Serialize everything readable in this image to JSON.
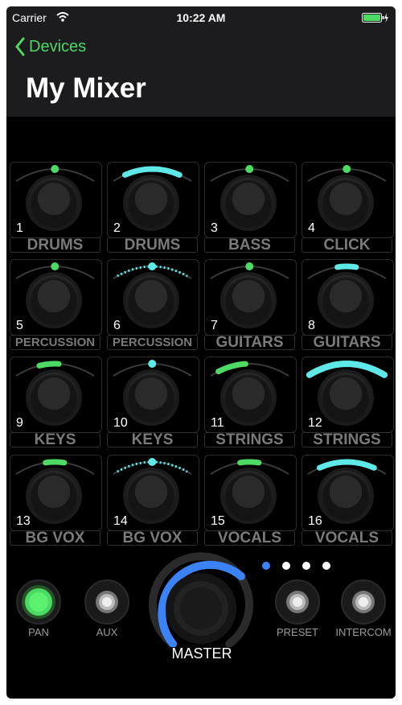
{
  "status": {
    "carrier": "Carrier",
    "time": "10:22 AM"
  },
  "nav": {
    "back_label": "Devices",
    "title": "My Mixer"
  },
  "colors": {
    "green": "#4cd964",
    "cyan": "#5ee8e8",
    "blue": "#3b82f6"
  },
  "channels": [
    {
      "number": "1",
      "label": "DRUMS",
      "meter": "dot-green"
    },
    {
      "number": "2",
      "label": "DRUMS",
      "meter": "arc-cyan-mid"
    },
    {
      "number": "3",
      "label": "BASS",
      "meter": "dot-green"
    },
    {
      "number": "4",
      "label": "CLICK",
      "meter": "dot-green"
    },
    {
      "number": "5",
      "label": "PERCUSSION",
      "meter": "dot-green"
    },
    {
      "number": "6",
      "label": "PERCUSSION",
      "meter": "dotted-cyan"
    },
    {
      "number": "7",
      "label": "GUITARS",
      "meter": "dot-green"
    },
    {
      "number": "8",
      "label": "GUITARS",
      "meter": "short-cyan"
    },
    {
      "number": "9",
      "label": "KEYS",
      "meter": "short-green"
    },
    {
      "number": "10",
      "label": "KEYS",
      "meter": "dot-cyan"
    },
    {
      "number": "11",
      "label": "STRINGS",
      "meter": "left-green"
    },
    {
      "number": "12",
      "label": "STRINGS",
      "meter": "full-cyan"
    },
    {
      "number": "13",
      "label": "BG VOX",
      "meter": "short-green-dot"
    },
    {
      "number": "14",
      "label": "BG VOX",
      "meter": "dotted-cyan"
    },
    {
      "number": "15",
      "label": "VOCALS",
      "meter": "short-green-dot"
    },
    {
      "number": "16",
      "label": "VOCALS",
      "meter": "arc-cyan-mid"
    }
  ],
  "controls": {
    "pan": "PAN",
    "aux": "AUX",
    "preset": "PRESET",
    "intercom": "INTERCOM",
    "master": "MASTER"
  },
  "page_dots": {
    "count": 4,
    "active": 1
  }
}
